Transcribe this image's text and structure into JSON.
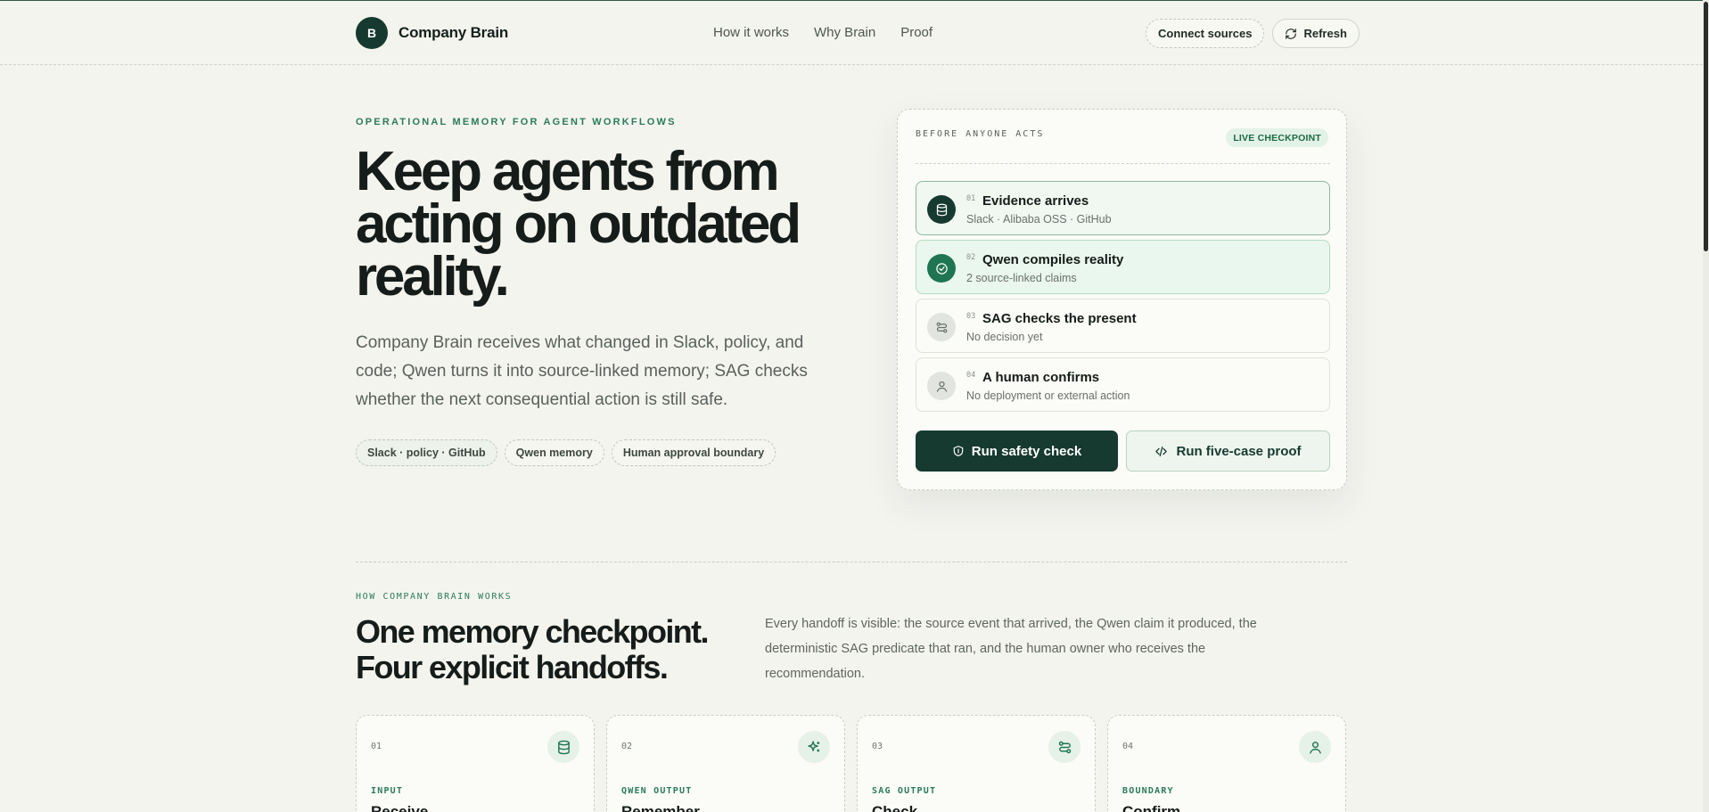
{
  "header": {
    "brand_initial": "B",
    "brand_name": "Company Brain",
    "nav": [
      "How it works",
      "Why Brain",
      "Proof"
    ],
    "connect_label": "Connect sources",
    "refresh_label": "Refresh"
  },
  "hero": {
    "eyebrow": "OPERATIONAL MEMORY FOR AGENT WORKFLOWS",
    "title": "Keep agents from acting on outdated reality.",
    "subtitle": "Company Brain receives what changed in Slack, policy, and code; Qwen turns it into source-linked memory; SAG checks whether the next consequential action is still safe.",
    "chips": [
      "Slack · policy · GitHub",
      "Qwen memory",
      "Human approval boundary"
    ]
  },
  "checkpoint": {
    "heading": "BEFORE ANYONE ACTS",
    "badge": "LIVE CHECKPOINT",
    "steps": [
      {
        "num": "01",
        "title": "Evidence arrives",
        "sub": "Slack · Alibaba OSS · GitHub",
        "icon": "database-icon"
      },
      {
        "num": "02",
        "title": "Qwen compiles reality",
        "sub": "2 source-linked claims",
        "icon": "check-circle-icon"
      },
      {
        "num": "03",
        "title": "SAG checks the present",
        "sub": "No decision yet",
        "icon": "route-icon"
      },
      {
        "num": "04",
        "title": "A human confirms",
        "sub": "No deployment or external action",
        "icon": "user-icon"
      }
    ],
    "primary_label": "Run safety check",
    "secondary_label": "Run five-case proof"
  },
  "how": {
    "eyebrow": "HOW COMPANY BRAIN WORKS",
    "title": "One memory checkpoint. Four explicit handoffs.",
    "description": "Every handoff is visible: the source event that arrived, the Qwen claim it produced, the deterministic SAG predicate that ran, and the human owner who receives the recommendation.",
    "cards": [
      {
        "num": "01",
        "label": "INPUT",
        "title": "Receive",
        "icon": "database-icon"
      },
      {
        "num": "02",
        "label": "QWEN OUTPUT",
        "title": "Remember",
        "icon": "sparkles-icon"
      },
      {
        "num": "03",
        "label": "SAG OUTPUT",
        "title": "Check",
        "icon": "route-icon"
      },
      {
        "num": "04",
        "label": "BOUNDARY",
        "title": "Confirm",
        "icon": "user-icon"
      }
    ]
  },
  "colors": {
    "accent_dark": "#163a2f",
    "accent_green": "#2a7c58",
    "background": "#f4f4ef"
  }
}
